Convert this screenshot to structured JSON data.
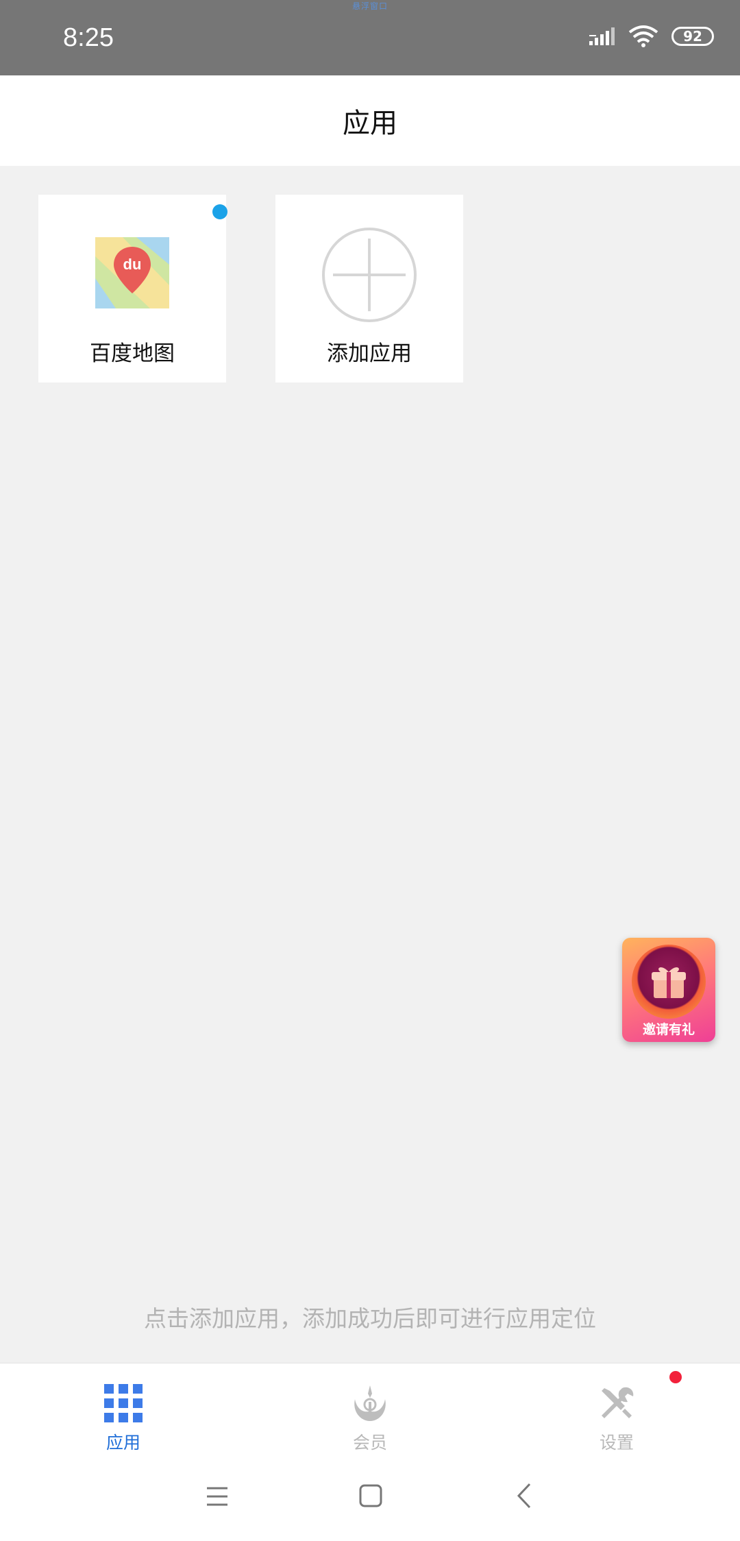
{
  "status_bar": {
    "time": "8:25",
    "battery": "92",
    "top_tiny_text": "悬浮窗口"
  },
  "header": {
    "title": "应用"
  },
  "apps": [
    {
      "label": "百度地图",
      "icon": "baidu-map-icon",
      "has_badge": true,
      "badge_color": "#1ba2e8"
    },
    {
      "label": "添加应用",
      "icon": "add-circle-icon",
      "has_badge": false
    }
  ],
  "map_icon_text": "du",
  "hint": "点击添加应用，添加成功后即可进行应用定位",
  "invite": {
    "label": "邀请有礼",
    "icon": "gift-icon"
  },
  "tabs": [
    {
      "label": "应用",
      "icon": "grid-icon",
      "active": true
    },
    {
      "label": "会员",
      "icon": "rebel-emblem-icon",
      "active": false
    },
    {
      "label": "设置",
      "icon": "tools-icon",
      "active": false,
      "has_badge": true
    }
  ],
  "colors": {
    "accent": "#1f6ed8",
    "status_bar": "#767676",
    "background": "#f1f1f1",
    "badge_red": "#f2213b"
  }
}
